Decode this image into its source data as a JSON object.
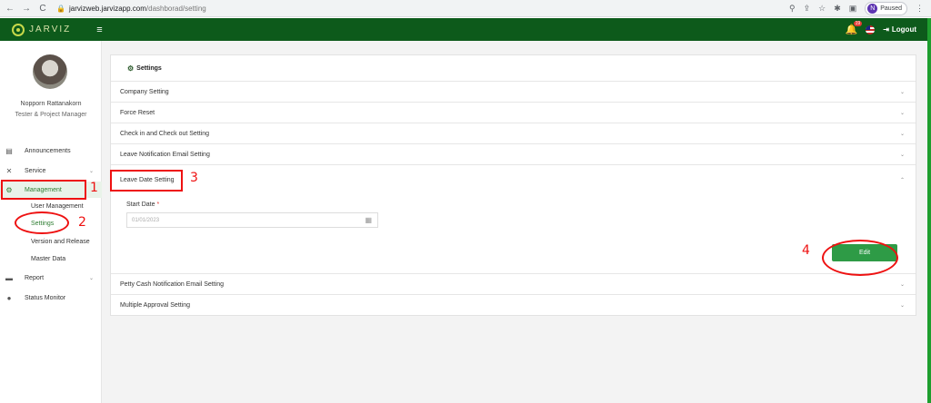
{
  "browser": {
    "back": "←",
    "forward": "→",
    "reload": "C",
    "host": "jarvizweb.jarvizapp.com",
    "path": "/dashborad/setting",
    "profile_initial": "N",
    "profile_label": "Paused"
  },
  "header": {
    "brand": "JARVIZ",
    "notif_count": "19",
    "logout_label": "Logout"
  },
  "user": {
    "name": "Nopporn Rattanakorn",
    "role": "Tester & Project Manager"
  },
  "sidebar": {
    "items": [
      {
        "label": "Announcements",
        "icon": "announcement-icon"
      },
      {
        "label": "Service",
        "icon": "tools-icon",
        "has_submenu": true
      },
      {
        "label": "Management",
        "icon": "gear-icon",
        "active": true
      },
      {
        "label": "Report",
        "icon": "folder-icon",
        "has_submenu": true
      },
      {
        "label": "Status Monitor",
        "icon": "location-icon"
      }
    ],
    "management_sub": [
      "User Management",
      "Settings",
      "Version and Release",
      "Master Data"
    ],
    "active_sub": "Settings"
  },
  "settings": {
    "title": "Settings",
    "sections": [
      "Company Setting",
      "Force Reset",
      "Check in and Check out Setting",
      "Leave Notification Email Setting",
      "Leave Date Setting",
      "Petty Cash Notification Email Setting",
      "Multiple Approval Setting"
    ],
    "open_section": "Leave Date Setting",
    "start_date_label": "Start Date",
    "required_mark": "*",
    "start_date_placeholder": "01/01/2023",
    "edit_label": "Edit"
  },
  "annotations": [
    "1",
    "2",
    "3",
    "4"
  ],
  "colors": {
    "header_bg": "#0d5a1b",
    "accent_green": "#2e9b46",
    "annotation_red": "#e11111"
  }
}
